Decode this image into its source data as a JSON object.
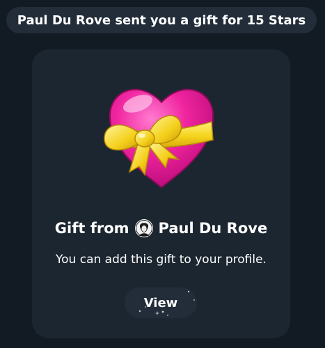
{
  "service_message": {
    "text": "Paul Du Rove sent you a gift for 15 Stars"
  },
  "gift_card": {
    "gift_from_prefix": "Gift from",
    "sender_name": "Paul Du Rove",
    "subtitle": "You can add this gift to your profile.",
    "view_button_label": "View",
    "gift_icon": "heart-with-ribbon",
    "avatar_icon": "user-avatar"
  },
  "colors": {
    "background": "#121a23",
    "pill": "#222d39",
    "card": "#1c2630",
    "text": "#ffffff",
    "heart": "#e8159a",
    "ribbon": "#f6d21c"
  }
}
